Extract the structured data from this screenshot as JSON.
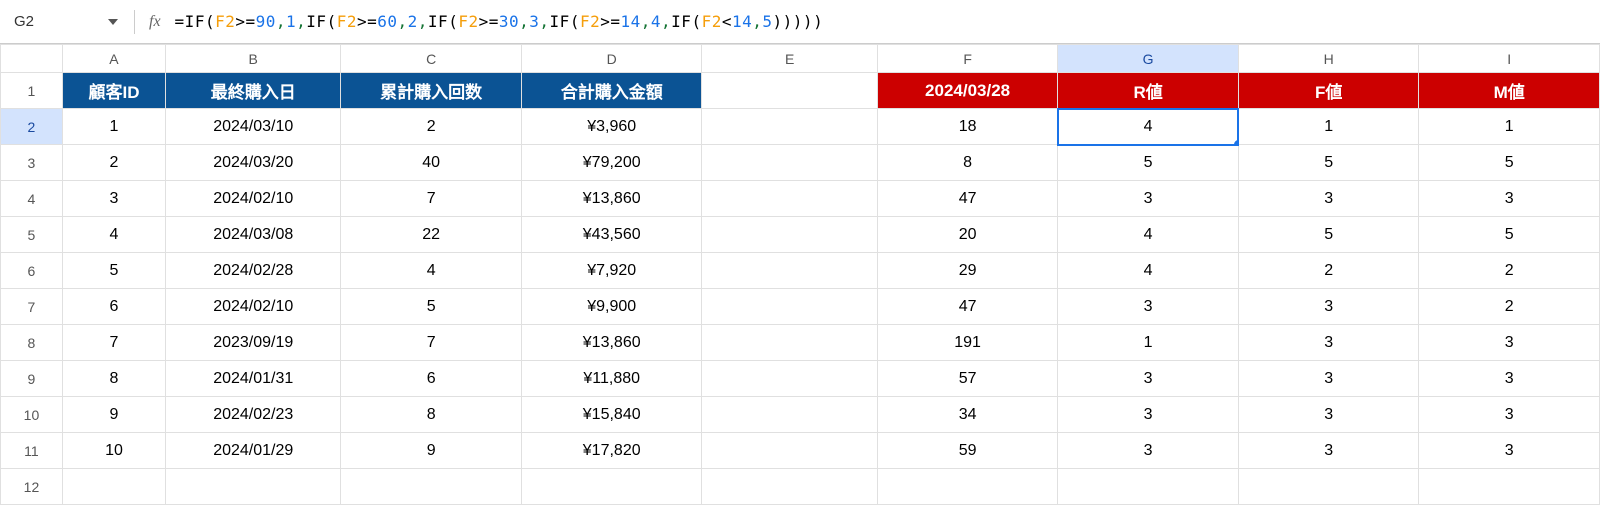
{
  "namebox": "G2",
  "fx_label": "fx",
  "formula_tokens": [
    {
      "t": "plain",
      "v": "=IF("
    },
    {
      "t": "ref",
      "v": "F2"
    },
    {
      "t": "plain",
      "v": ">="
    },
    {
      "t": "num",
      "v": "90"
    },
    {
      "t": "sep",
      "v": ","
    },
    {
      "t": "num",
      "v": "1"
    },
    {
      "t": "sep",
      "v": ","
    },
    {
      "t": "plain",
      "v": "IF("
    },
    {
      "t": "ref",
      "v": "F2"
    },
    {
      "t": "plain",
      "v": ">="
    },
    {
      "t": "num",
      "v": "60"
    },
    {
      "t": "sep",
      "v": ","
    },
    {
      "t": "num",
      "v": "2"
    },
    {
      "t": "sep",
      "v": ","
    },
    {
      "t": "plain",
      "v": "IF("
    },
    {
      "t": "ref",
      "v": "F2"
    },
    {
      "t": "plain",
      "v": ">="
    },
    {
      "t": "num",
      "v": "30"
    },
    {
      "t": "sep",
      "v": ","
    },
    {
      "t": "num",
      "v": "3"
    },
    {
      "t": "sep",
      "v": ","
    },
    {
      "t": "plain",
      "v": "IF("
    },
    {
      "t": "ref",
      "v": "F2"
    },
    {
      "t": "plain",
      "v": ">="
    },
    {
      "t": "num",
      "v": "14"
    },
    {
      "t": "sep",
      "v": ","
    },
    {
      "t": "num",
      "v": "4"
    },
    {
      "t": "sep",
      "v": ","
    },
    {
      "t": "plain",
      "v": "IF("
    },
    {
      "t": "ref",
      "v": "F2"
    },
    {
      "t": "plain",
      "v": "<"
    },
    {
      "t": "num",
      "v": "14"
    },
    {
      "t": "sep",
      "v": ","
    },
    {
      "t": "num",
      "v": "5"
    },
    {
      "t": "plain",
      "v": ")))))"
    }
  ],
  "columns": [
    "A",
    "B",
    "C",
    "D",
    "E",
    "F",
    "G",
    "H",
    "I"
  ],
  "col_widths": [
    "wA",
    "wB",
    "wC",
    "wD",
    "wE",
    "wF",
    "wG",
    "wH",
    "wI"
  ],
  "selected_col": "G",
  "selected_row": 2,
  "header_row": {
    "A": {
      "text": "顧客ID",
      "cls": "hdr-blue"
    },
    "B": {
      "text": "最終購入日",
      "cls": "hdr-blue"
    },
    "C": {
      "text": "累計購入回数",
      "cls": "hdr-blue"
    },
    "D": {
      "text": "合計購入金額",
      "cls": "hdr-blue"
    },
    "E": {
      "text": "",
      "cls": ""
    },
    "F": {
      "text": "2024/03/28",
      "cls": "hdr-red"
    },
    "G": {
      "text": "R値",
      "cls": "hdr-red"
    },
    "H": {
      "text": "F値",
      "cls": "hdr-red"
    },
    "I": {
      "text": "M値",
      "cls": "hdr-red"
    }
  },
  "rows": [
    {
      "n": 2,
      "A": "1",
      "B": "2024/03/10",
      "C": "2",
      "D": "¥3,960",
      "E": "",
      "F": "18",
      "G": "4",
      "H": "1",
      "I": "1"
    },
    {
      "n": 3,
      "A": "2",
      "B": "2024/03/20",
      "C": "40",
      "D": "¥79,200",
      "E": "",
      "F": "8",
      "G": "5",
      "H": "5",
      "I": "5"
    },
    {
      "n": 4,
      "A": "3",
      "B": "2024/02/10",
      "C": "7",
      "D": "¥13,860",
      "E": "",
      "F": "47",
      "G": "3",
      "H": "3",
      "I": "3"
    },
    {
      "n": 5,
      "A": "4",
      "B": "2024/03/08",
      "C": "22",
      "D": "¥43,560",
      "E": "",
      "F": "20",
      "G": "4",
      "H": "5",
      "I": "5"
    },
    {
      "n": 6,
      "A": "5",
      "B": "2024/02/28",
      "C": "4",
      "D": "¥7,920",
      "E": "",
      "F": "29",
      "G": "4",
      "H": "2",
      "I": "2"
    },
    {
      "n": 7,
      "A": "6",
      "B": "2024/02/10",
      "C": "5",
      "D": "¥9,900",
      "E": "",
      "F": "47",
      "G": "3",
      "H": "3",
      "I": "2"
    },
    {
      "n": 8,
      "A": "7",
      "B": "2023/09/19",
      "C": "7",
      "D": "¥13,860",
      "E": "",
      "F": "191",
      "G": "1",
      "H": "3",
      "I": "3"
    },
    {
      "n": 9,
      "A": "8",
      "B": "2024/01/31",
      "C": "6",
      "D": "¥11,880",
      "E": "",
      "F": "57",
      "G": "3",
      "H": "3",
      "I": "3"
    },
    {
      "n": 10,
      "A": "9",
      "B": "2024/02/23",
      "C": "8",
      "D": "¥15,840",
      "E": "",
      "F": "34",
      "G": "3",
      "H": "3",
      "I": "3"
    },
    {
      "n": 11,
      "A": "10",
      "B": "2024/01/29",
      "C": "9",
      "D": "¥17,820",
      "E": "",
      "F": "59",
      "G": "3",
      "H": "3",
      "I": "3"
    },
    {
      "n": 12,
      "A": "",
      "B": "",
      "C": "",
      "D": "",
      "E": "",
      "F": "",
      "G": "",
      "H": "",
      "I": ""
    }
  ]
}
